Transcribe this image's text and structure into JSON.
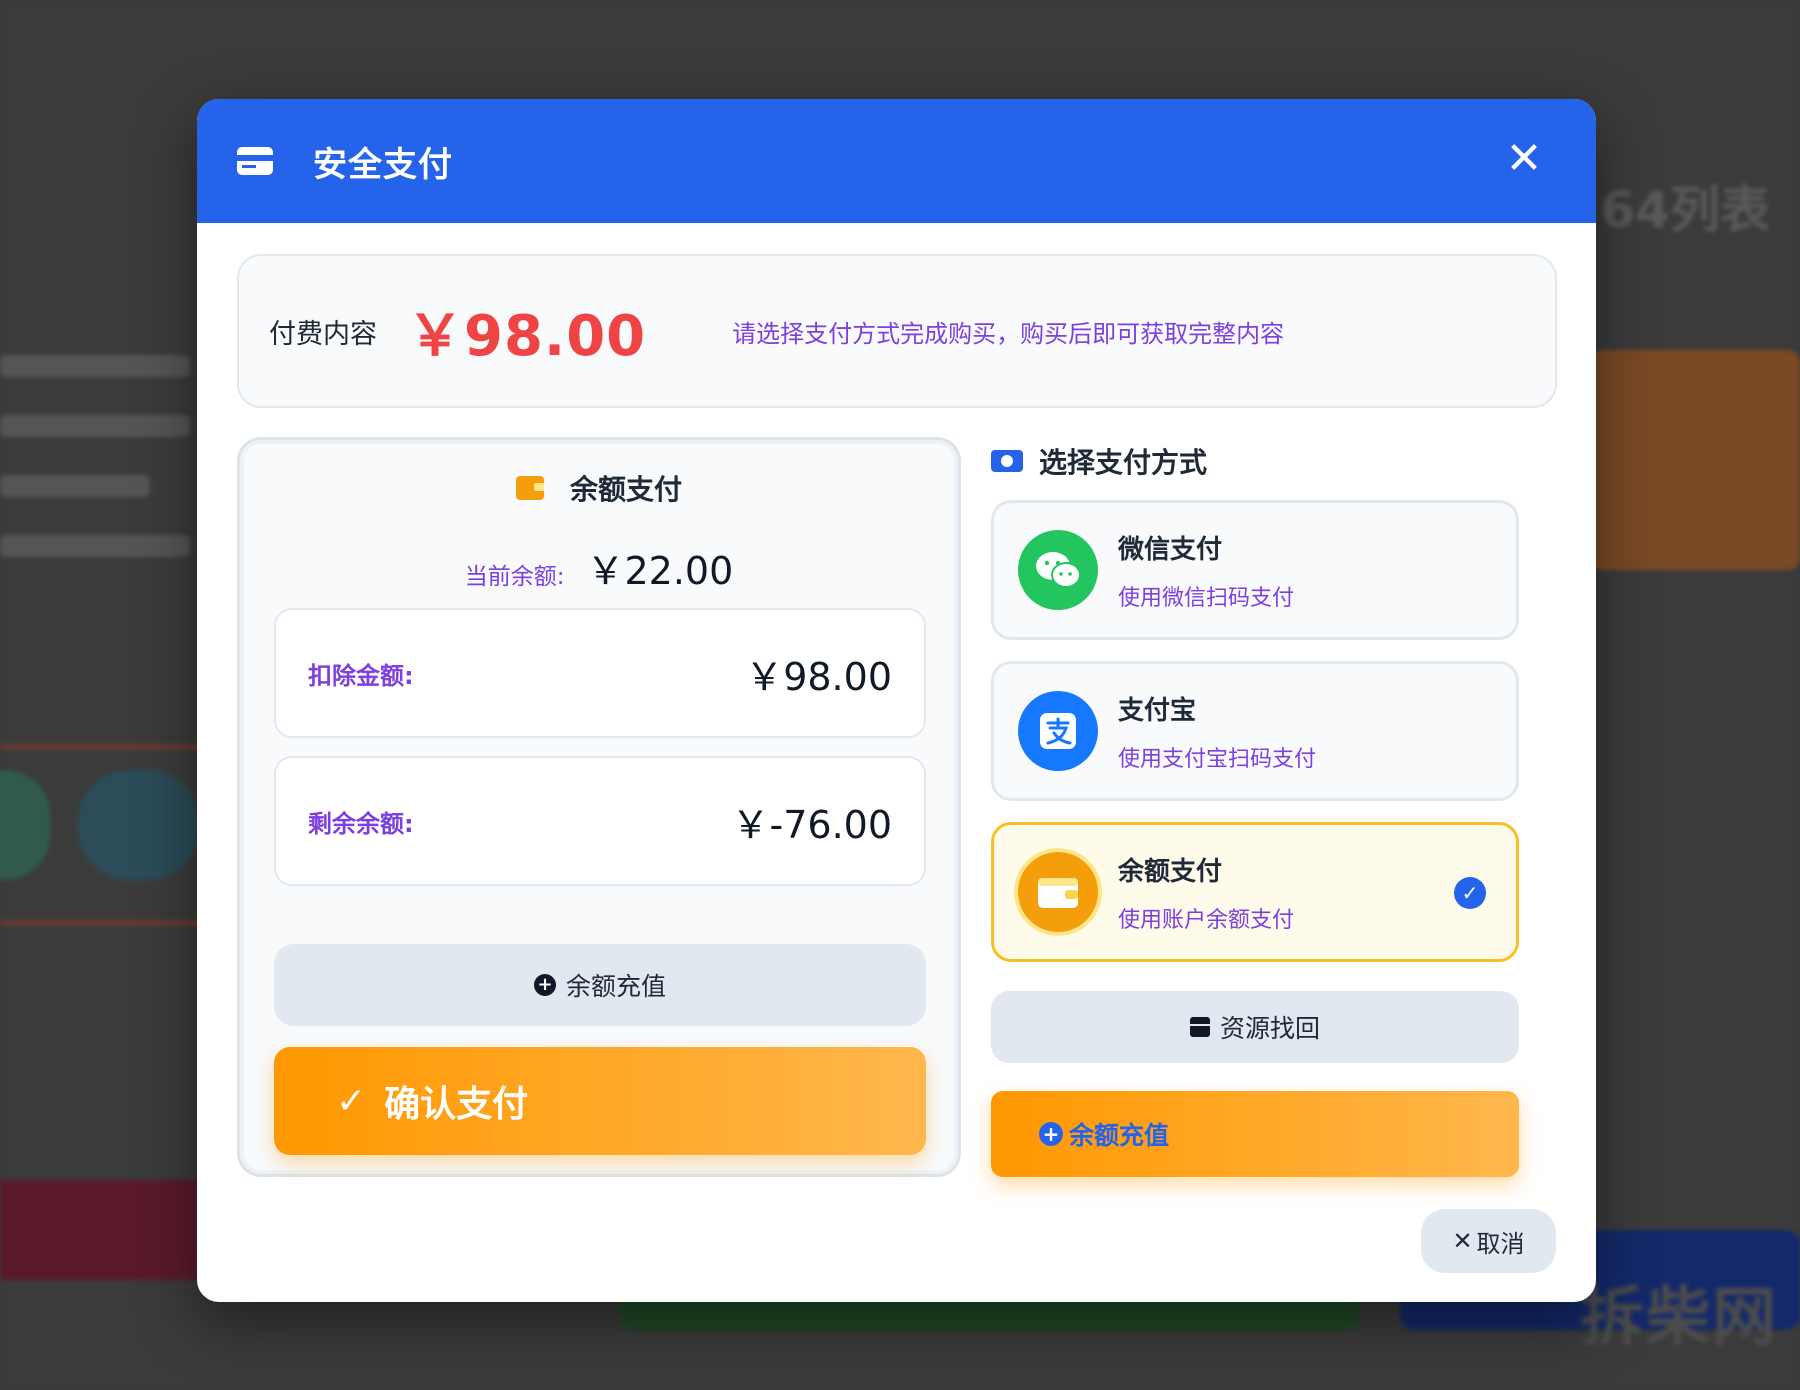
{
  "dialog": {
    "title": "安全支付",
    "header_icon": "credit-card-icon",
    "close_icon": "close-icon"
  },
  "summary": {
    "label": "付费内容",
    "price": "￥98.00",
    "hint": "请选择支付方式完成购买，购买后即可获取完整内容"
  },
  "balance_panel": {
    "title": "余额支付",
    "title_icon": "wallet-icon",
    "current_label": "当前余额:",
    "current_value": "￥22.00",
    "deduct_label": "扣除金额:",
    "deduct_value": "￥98.00",
    "remain_label": "剩余余额:",
    "remain_value": "￥-76.00",
    "recharge_label": "余额充值",
    "recharge_icon": "plus-circle-icon",
    "confirm_label": "确认支付",
    "confirm_icon": "check-icon"
  },
  "methods": {
    "title": "选择支付方式",
    "title_icon": "money-icon",
    "items": [
      {
        "name": "微信支付",
        "desc": "使用微信扫码支付",
        "icon": "wechat-icon",
        "color": "#22c55e",
        "selected": false
      },
      {
        "name": "支付宝",
        "desc": "使用支付宝扫码支付",
        "icon": "alipay-icon",
        "color": "#1677ff",
        "selected": false
      },
      {
        "name": "余额支付",
        "desc": "使用账户余额支付",
        "icon": "wallet-icon",
        "color": "#f59e0b",
        "selected": true
      }
    ],
    "resource_label": "资源找回",
    "resource_icon": "box-icon",
    "recharge_label": "余额充值",
    "recharge_icon": "plus-circle-icon"
  },
  "cancel": {
    "label": "取消",
    "icon": "close-icon"
  },
  "background": {
    "watermark": "拆柴网",
    "heading": "64列表"
  },
  "colors": {
    "header": "#2563eb",
    "price": "#ef4444",
    "accent_purple": "#7e3fe0",
    "confirm_orange": "#ff9800",
    "selected_border": "#fbbf24"
  }
}
